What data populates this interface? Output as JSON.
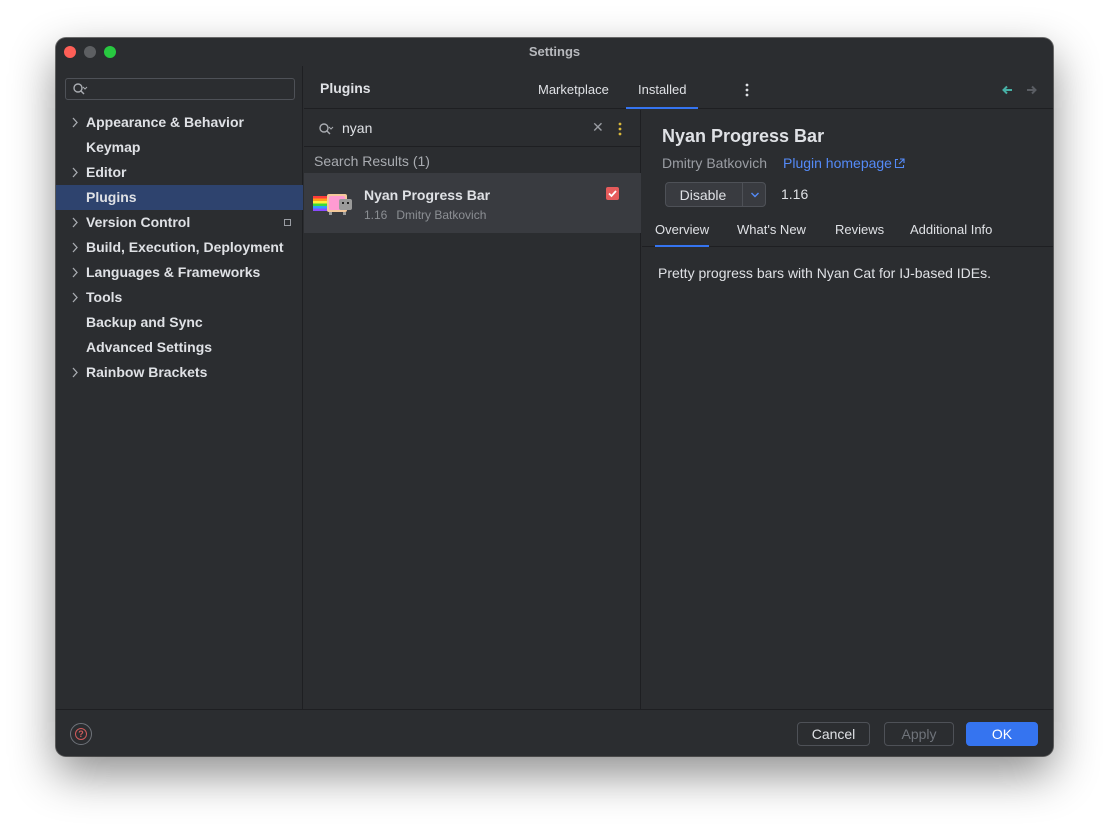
{
  "window": {
    "title": "Settings"
  },
  "sidebar": {
    "search_placeholder": "",
    "items": [
      {
        "label": "Appearance & Behavior",
        "expandable": true
      },
      {
        "label": "Keymap",
        "expandable": false
      },
      {
        "label": "Editor",
        "expandable": true
      },
      {
        "label": "Plugins",
        "expandable": false,
        "selected": true
      },
      {
        "label": "Version Control",
        "expandable": true
      },
      {
        "label": "Build, Execution, Deployment",
        "expandable": true
      },
      {
        "label": "Languages & Frameworks",
        "expandable": true
      },
      {
        "label": "Tools",
        "expandable": true
      },
      {
        "label": "Backup and Sync",
        "expandable": false
      },
      {
        "label": "Advanced Settings",
        "expandable": false
      },
      {
        "label": "Rainbow Brackets",
        "expandable": true
      }
    ]
  },
  "header": {
    "title": "Plugins",
    "tabs": [
      {
        "label": "Marketplace"
      },
      {
        "label": "Installed",
        "active": true
      }
    ]
  },
  "plugin_list": {
    "query": "nyan",
    "results_label": "Search Results (1)",
    "results": [
      {
        "name": "Nyan Progress Bar",
        "version": "1.16",
        "vendor": "Dmitry Batkovich",
        "enabled": true
      }
    ]
  },
  "detail": {
    "name": "Nyan Progress Bar",
    "vendor": "Dmitry Batkovich",
    "homepage_label": "Plugin homepage",
    "action_label": "Disable",
    "version": "1.16",
    "tabs": [
      {
        "label": "Overview",
        "active": true
      },
      {
        "label": "What's New"
      },
      {
        "label": "Reviews"
      },
      {
        "label": "Additional Info"
      }
    ],
    "description": "Pretty progress bars with Nyan Cat for IJ-based IDEs."
  },
  "footer": {
    "cancel_label": "Cancel",
    "apply_label": "Apply",
    "ok_label": "OK"
  },
  "colors": {
    "accent": "#3574f0",
    "link": "#548af7",
    "selection": "#2e436e",
    "checkbox": "#e55b5b"
  }
}
